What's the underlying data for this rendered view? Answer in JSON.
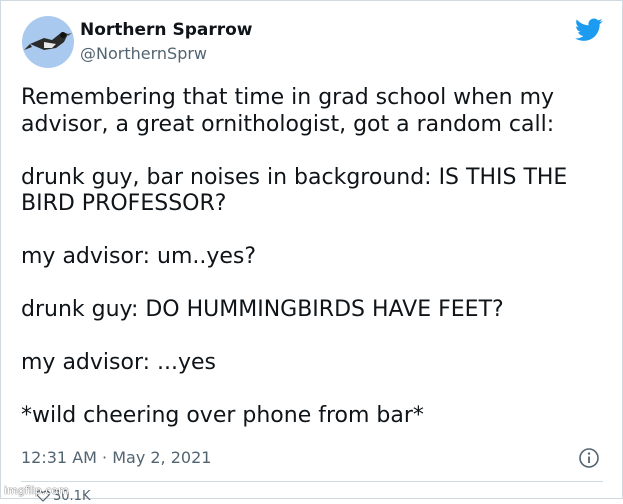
{
  "author": {
    "name": "Northern Sparrow",
    "handle": "@NorthernSprw",
    "avatar_icon": "sparrow-avatar-icon",
    "avatar_bg": "#aac9ef"
  },
  "brand": {
    "icon": "twitter-bird-icon",
    "color": "#1d9bf0"
  },
  "tweet": {
    "lines": [
      "Remembering that time in grad school when my",
      "advisor, a great ornithologist, got a random call:",
      "drunk guy, bar noises in background: IS THIS THE",
      "BIRD PROFESSOR?",
      "my advisor: um..yes?",
      "drunk guy: DO HUMMINGBIRDS HAVE FEET?",
      "my advisor: ...yes",
      "*wild cheering over phone from bar*"
    ]
  },
  "meta": {
    "timestamp": "12:31 AM · May 2, 2021",
    "info_icon": "info-icon"
  },
  "engagement": {
    "likes_label": "30.1K",
    "heart_icon": "heart-icon"
  },
  "watermark": "imgflip.com"
}
